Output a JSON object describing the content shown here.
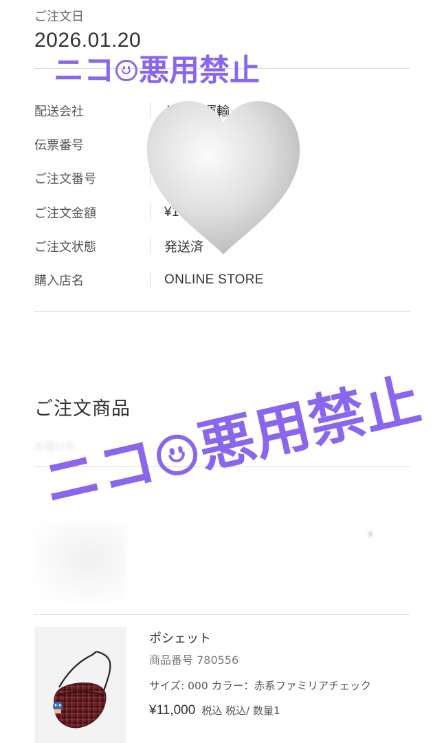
{
  "order": {
    "date_label": "ご注文日",
    "date": "2026.01.20",
    "info": [
      {
        "label": "配送会社",
        "value": "ヤマト運輸"
      },
      {
        "label": "伝票番号",
        "value": ""
      },
      {
        "label": "ご注文番号",
        "value": ""
      },
      {
        "label": "ご注文金額",
        "value": "¥1"
      },
      {
        "label": "ご注文状態",
        "value": "発送済"
      },
      {
        "label": "購入店名",
        "value": "ONLINE STORE"
      }
    ]
  },
  "items_section": {
    "title": "ご注文商品",
    "faded_text": "お届け先",
    "product": {
      "name": "ポシェット",
      "number": "商品番号 780556",
      "variant": "サイズ: 000 カラー：赤系ファミリアチェック",
      "price": "¥11,000",
      "tax_qty": "税込 税込/ 数量1"
    }
  },
  "overlays": {
    "watermark_text_1": "ニコ",
    "watermark_text_2": "悪用禁止",
    "heart_icon": "white-heart-icon",
    "watermark_color": "#8a66ee"
  }
}
